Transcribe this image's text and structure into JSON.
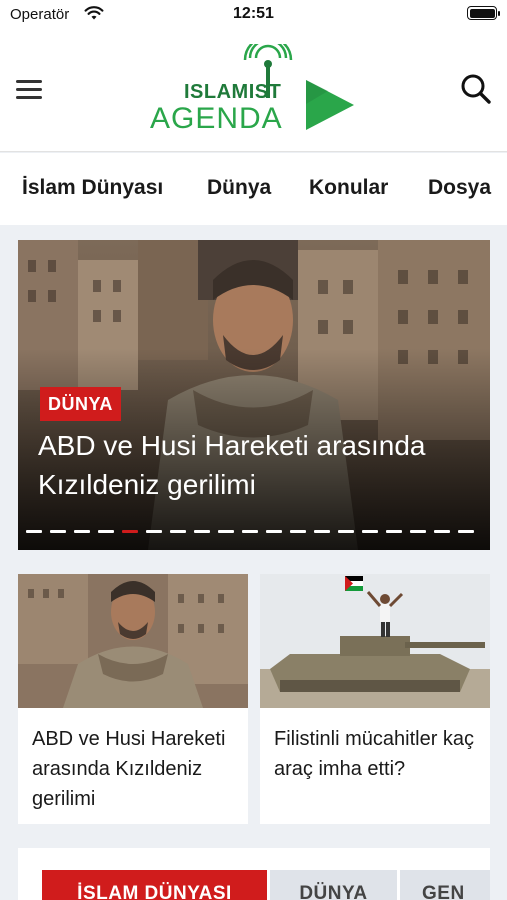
{
  "status_bar": {
    "carrier": "Operatör",
    "time": "12:51"
  },
  "header": {
    "logo_top": "ISLAM☐ST",
    "logo_top_text": "ISLAMIST",
    "logo_bottom": "AGENDA",
    "colors": {
      "logo_green": "#2aa64a",
      "logo_dark_green": "#1f7a3a"
    }
  },
  "category_nav": [
    "İslam Dünyası",
    "Dünya",
    "Konular",
    "Dosya"
  ],
  "hero": {
    "badge": "DÜNYA",
    "title": "ABD ve Husi Hareketi arasında Kızıldeniz gerilimi",
    "slide_count": 19,
    "active_slide": 5,
    "colors": {
      "badge": "#d01c1c",
      "active_dot": "#d01c1c"
    }
  },
  "cards": [
    {
      "title": "ABD ve Husi Hareketi arasında Kızıldeniz gerilimi"
    },
    {
      "title": "Filistinli mücahitler kaç araç imha etti?"
    }
  ],
  "section_tabs": [
    {
      "label": "İSLAM DÜNYASI",
      "active": true
    },
    {
      "label": "DÜNYA",
      "active": false
    },
    {
      "label": "GEN",
      "active": false
    }
  ]
}
